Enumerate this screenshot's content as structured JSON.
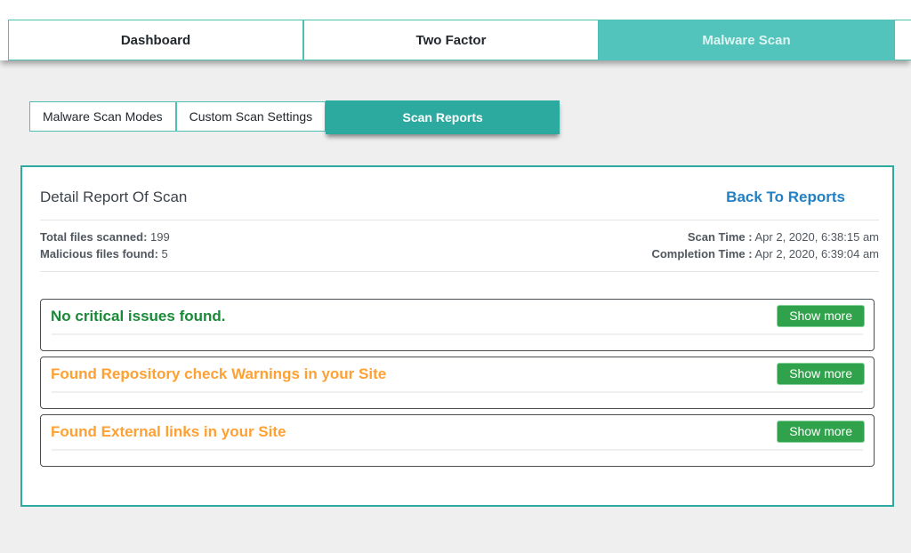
{
  "top_tabs": {
    "items": [
      {
        "label": "Dashboard",
        "active": false
      },
      {
        "label": "Two Factor",
        "active": false
      },
      {
        "label": "Malware Scan",
        "active": true
      }
    ]
  },
  "sub_tabs": {
    "items": [
      {
        "label": "Malware Scan Modes",
        "active": false
      },
      {
        "label": "Custom Scan Settings",
        "active": false
      },
      {
        "label": "Scan Reports",
        "active": true
      }
    ]
  },
  "report": {
    "title": "Detail Report Of Scan",
    "back_link": "Back To Reports",
    "stats": {
      "total_label": "Total files scanned:",
      "total_value": "199",
      "malicious_label": "Malicious files found:",
      "malicious_value": "5",
      "scan_time_label": "Scan Time :",
      "scan_time_value": "Apr 2, 2020, 6:38:15 am",
      "completion_label": "Completion Time :",
      "completion_value": "Apr 2, 2020, 6:39:04 am"
    },
    "results": [
      {
        "message": "No critical issues found.",
        "status": "success",
        "button_label": "Show more"
      },
      {
        "message": "Found Repository check Warnings in your Site",
        "status": "warning",
        "button_label": "Show more"
      },
      {
        "message": "Found External links in your Site",
        "status": "warning",
        "button_label": "Show more"
      }
    ]
  },
  "colors": {
    "accent_teal_light": "#52c4bb",
    "accent_teal_dark": "#2caaa0",
    "tab_border_teal": "#4cc0b5",
    "link_blue": "#2380c2",
    "success_green_text": "#1a8a38",
    "warning_orange_text": "#ffa033",
    "button_green": "#31a24c",
    "page_background": "#efefef"
  }
}
